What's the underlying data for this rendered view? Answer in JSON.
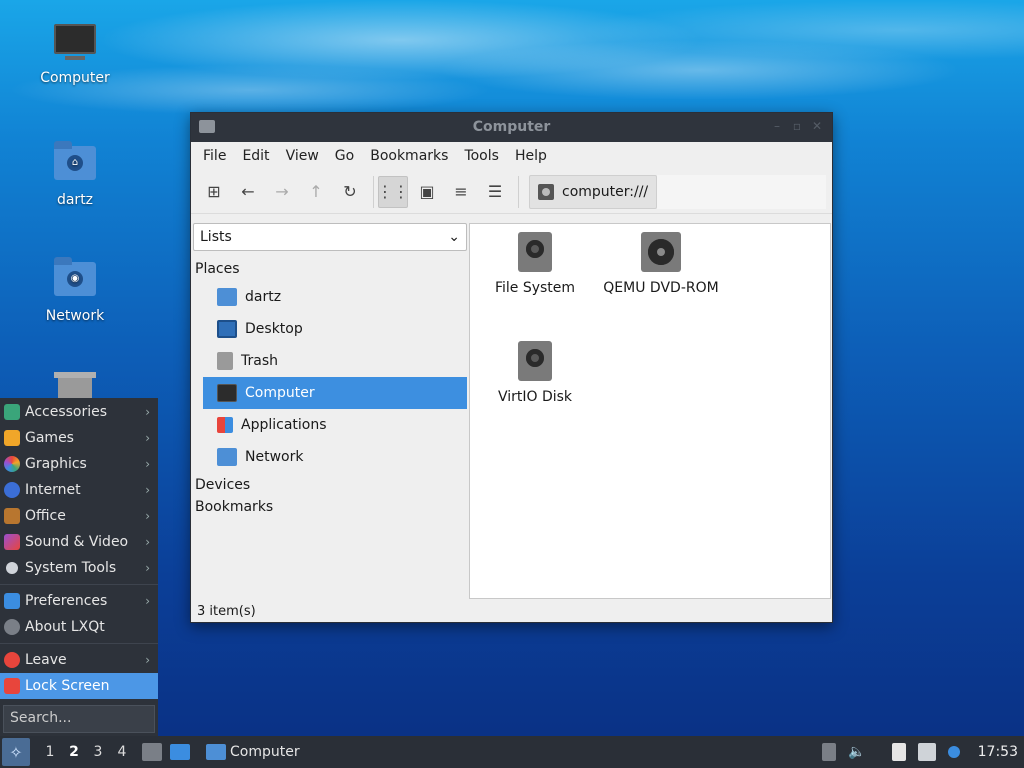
{
  "desktop": {
    "icons": [
      {
        "label": "Computer"
      },
      {
        "label": "dartz"
      },
      {
        "label": "Network"
      }
    ]
  },
  "window": {
    "title": "Computer",
    "menu": [
      "File",
      "Edit",
      "View",
      "Go",
      "Bookmarks",
      "Tools",
      "Help"
    ],
    "path": "computer:///",
    "sidebar": {
      "combo": "Lists",
      "places_header": "Places",
      "places": [
        "dartz",
        "Desktop",
        "Trash",
        "Computer",
        "Applications",
        "Network"
      ],
      "selected": "Computer",
      "devices_header": "Devices",
      "bookmarks_header": "Bookmarks"
    },
    "items": [
      "File System",
      "QEMU DVD-ROM",
      "VirtIO Disk"
    ],
    "status": "3 item(s)"
  },
  "startmenu": {
    "items": [
      "Accessories",
      "Games",
      "Graphics",
      "Internet",
      "Office",
      "Sound & Video",
      "System Tools"
    ],
    "items2": [
      "Preferences",
      "About LXQt"
    ],
    "items3": [
      "Leave",
      "Lock Screen"
    ],
    "search_placeholder": "Search..."
  },
  "taskbar": {
    "workspaces": [
      "1",
      "2",
      "3",
      "4"
    ],
    "current_workspace": "2",
    "task_label": "Computer",
    "clock": "17:53"
  },
  "colors": {
    "selection": "#3d8fe0",
    "menu_selection": "#4c97e6",
    "panel": "#2a2f37"
  }
}
